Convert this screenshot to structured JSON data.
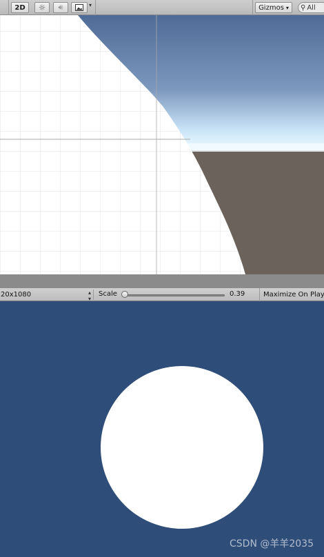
{
  "scene_toolbar": {
    "btn_2d": "2D",
    "light_icon": "sun-icon",
    "audio_icon": "speaker-icon",
    "fx_icon": "image-icon",
    "gizmos_label": "Gizmos",
    "search_text": "All"
  },
  "game_toolbar": {
    "resolution": "20x1080",
    "scale_label": "Scale",
    "scale_value": "0.39",
    "scale_level": 0.0,
    "maximize_label": "Maximize On Play"
  },
  "colors": {
    "game_background": "#2f4d79",
    "sky_top": "#4f6b97",
    "horizon": "#e8f6ff",
    "ground": "#6b625b",
    "circle": "#ffffff"
  },
  "watermark": "CSDN @羊羊2035"
}
